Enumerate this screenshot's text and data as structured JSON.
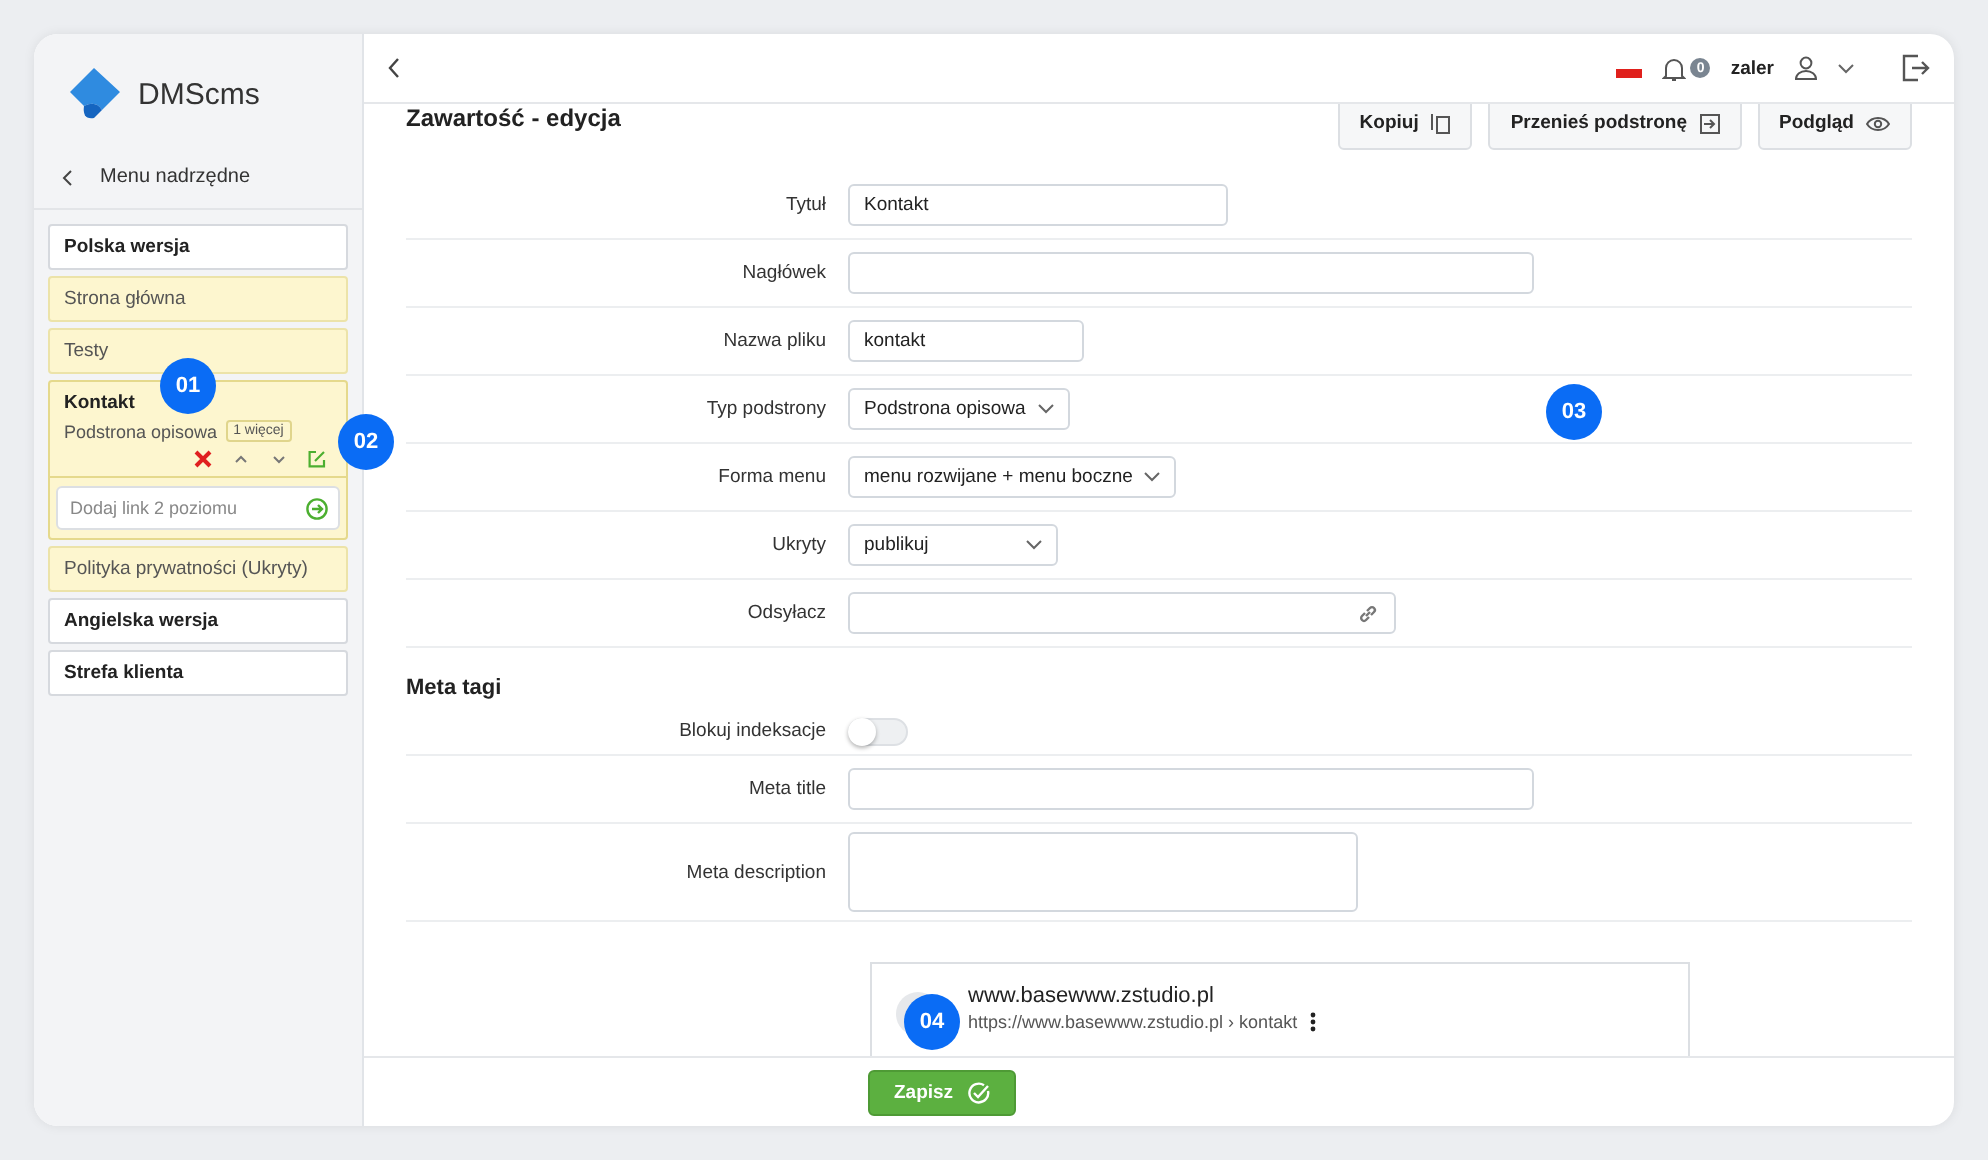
{
  "sidebar": {
    "logo": "DMScms",
    "back": {
      "label": "Menu nadrzędne"
    },
    "items": [
      {
        "label": "Polska wersja",
        "kind": "section"
      },
      {
        "label": "Strona główna",
        "kind": "page"
      },
      {
        "label": "Testy",
        "kind": "page"
      },
      {
        "label": "Kontakt",
        "kind": "open",
        "subtitle": "Podstrona opisowa",
        "tag": "1 więcej",
        "add_placeholder": "Dodaj link 2 poziomu"
      },
      {
        "label": "Polityka prywatności (Ukryty)",
        "kind": "page"
      },
      {
        "label": "Angielska wersja",
        "kind": "section"
      },
      {
        "label": "Strefa klienta",
        "kind": "section"
      }
    ]
  },
  "topbar": {
    "notifications": "0",
    "user": "zaler"
  },
  "title": "Zawartość - edycja",
  "actions": [
    {
      "label": "Kopiuj",
      "kind": "copy"
    },
    {
      "label": "Przenieś podstronę",
      "kind": "move"
    },
    {
      "label": "Podgląd",
      "kind": "preview"
    }
  ],
  "fields": [
    {
      "label": "Tytuł",
      "kind": "text",
      "value": "Kontakt"
    },
    {
      "label": "Nagłówek",
      "kind": "text"
    },
    {
      "label": "Nazwa pliku",
      "kind": "text",
      "value": "kontakt"
    },
    {
      "label": "Typ podstrony",
      "kind": "select",
      "value": "Podstrona opisowa"
    },
    {
      "label": "Forma menu",
      "kind": "select",
      "value": "menu rozwijane + menu boczne"
    },
    {
      "label": "Ukryty",
      "kind": "select",
      "value": "publikuj"
    },
    {
      "label": "Odsyłacz",
      "kind": "link"
    }
  ],
  "meta": {
    "heading": "Meta tagi",
    "fields": [
      {
        "label": "Blokuj indeksacje",
        "kind": "toggle",
        "on": false
      },
      {
        "label": "Meta title",
        "kind": "text"
      },
      {
        "label": "Meta description",
        "kind": "textarea"
      }
    ]
  },
  "preview": {
    "site": "www.basewww.zstudio.pl",
    "url": "https://www.basewww.zstudio.pl › kontakt"
  },
  "save": "Zapisz",
  "markers": [
    "01",
    "02",
    "03",
    "04"
  ]
}
